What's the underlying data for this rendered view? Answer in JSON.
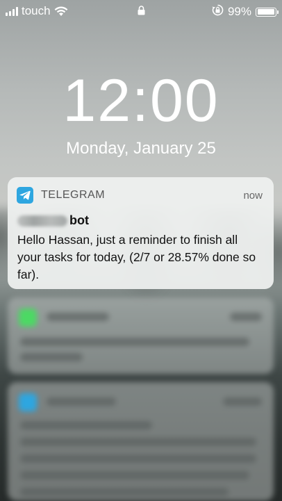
{
  "status_bar": {
    "carrier": "touch",
    "battery_percent": "99%",
    "battery_level": 0.99
  },
  "lock_screen": {
    "time": "12:00",
    "date": "Monday, January 25"
  },
  "notification": {
    "app_name": "TELEGRAM",
    "time": "now",
    "sender_suffix": "bot",
    "message": "Hello Hassan, just a reminder to finish all your tasks for today, (2/7 or 28.57% done so far).",
    "colors": {
      "telegram_blue": "#2ea6e0"
    }
  },
  "blurred_notifications": [
    {
      "icon_color": "#4cd964"
    },
    {
      "icon_color": "#2ea6e0"
    }
  ]
}
